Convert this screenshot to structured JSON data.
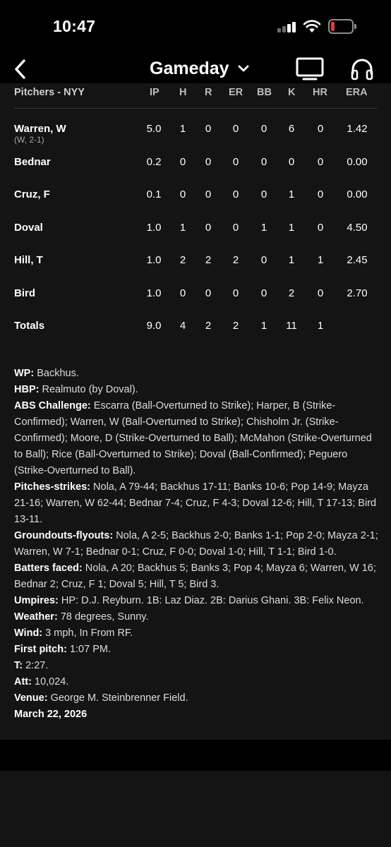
{
  "status_bar": {
    "time": "10:47",
    "battery_color": "#e5393b"
  },
  "nav": {
    "title": "Gameday",
    "icons": [
      "chevron-left-icon",
      "chevron-down-icon",
      "tv-icon",
      "headphones-icon"
    ]
  },
  "table": {
    "headers": [
      "Pitchers - NYY",
      "IP",
      "H",
      "R",
      "ER",
      "BB",
      "K",
      "HR",
      "ERA"
    ],
    "rows": [
      {
        "name": "Warren, W",
        "note": "(W, 2-1)",
        "stats": [
          "5.0",
          "1",
          "0",
          "0",
          "0",
          "6",
          "0",
          "1.42"
        ]
      },
      {
        "name": "Bednar",
        "note": "",
        "stats": [
          "0.2",
          "0",
          "0",
          "0",
          "0",
          "0",
          "0",
          "0.00"
        ]
      },
      {
        "name": "Cruz, F",
        "note": "",
        "stats": [
          "0.1",
          "0",
          "0",
          "0",
          "0",
          "1",
          "0",
          "0.00"
        ]
      },
      {
        "name": "Doval",
        "note": "",
        "stats": [
          "1.0",
          "1",
          "0",
          "0",
          "1",
          "1",
          "0",
          "4.50"
        ]
      },
      {
        "name": "Hill, T",
        "note": "",
        "stats": [
          "1.0",
          "2",
          "2",
          "2",
          "0",
          "1",
          "1",
          "2.45"
        ]
      },
      {
        "name": "Bird",
        "note": "",
        "stats": [
          "1.0",
          "0",
          "0",
          "0",
          "0",
          "2",
          "0",
          "2.70"
        ]
      }
    ],
    "totals": {
      "name": "Totals",
      "stats": [
        "9.0",
        "4",
        "2",
        "2",
        "1",
        "11",
        "1",
        ""
      ]
    }
  },
  "notes": [
    {
      "label": "WP:",
      "text": "Backhus."
    },
    {
      "label": "HBP:",
      "text": "Realmuto (by Doval)."
    },
    {
      "label": "ABS Challenge:",
      "text": "Escarra (Ball-Overturned to Strike); Harper, B (Strike-Confirmed); Warren, W (Ball-Overturned to Strike); Chisholm Jr. (Strike-Confirmed); Moore, D (Strike-Overturned to Ball); McMahon (Strike-Overturned to Ball); Rice (Ball-Overturned to Strike); Doval (Ball-Confirmed); Peguero (Strike-Overturned to Ball)."
    },
    {
      "label": "Pitches-strikes:",
      "text": "Nola, A 79-44; Backhus 17-11; Banks 10-6; Pop 14-9; Mayza 21-16; Warren, W 62-44; Bednar 7-4; Cruz, F 4-3; Doval 12-6; Hill, T 17-13; Bird 13-11."
    },
    {
      "label": "Groundouts-flyouts:",
      "text": "Nola, A 2-5; Backhus 2-0; Banks 1-1; Pop 2-0; Mayza 2-1; Warren, W 7-1; Bednar 0-1; Cruz, F 0-0; Doval 1-0; Hill, T 1-1; Bird 1-0."
    },
    {
      "label": "Batters faced:",
      "text": "Nola, A 20; Backhus 5; Banks 3; Pop 4; Mayza 6; Warren, W 16; Bednar 2; Cruz, F 1; Doval 5; Hill, T 5; Bird 3."
    },
    {
      "label": "Umpires:",
      "text": "HP: D.J. Reyburn. 1B: Laz Diaz. 2B: Darius Ghani. 3B: Felix Neon."
    },
    {
      "label": "Weather:",
      "text": "78 degrees, Sunny."
    },
    {
      "label": "Wind:",
      "text": "3 mph, In From RF."
    },
    {
      "label": "First pitch:",
      "text": "1:07 PM."
    },
    {
      "label": "T:",
      "text": "2:27."
    },
    {
      "label": "Att:",
      "text": "10,024."
    },
    {
      "label": "Venue:",
      "text": "George M. Steinbrenner Field."
    }
  ],
  "game_date": "March 22, 2026"
}
